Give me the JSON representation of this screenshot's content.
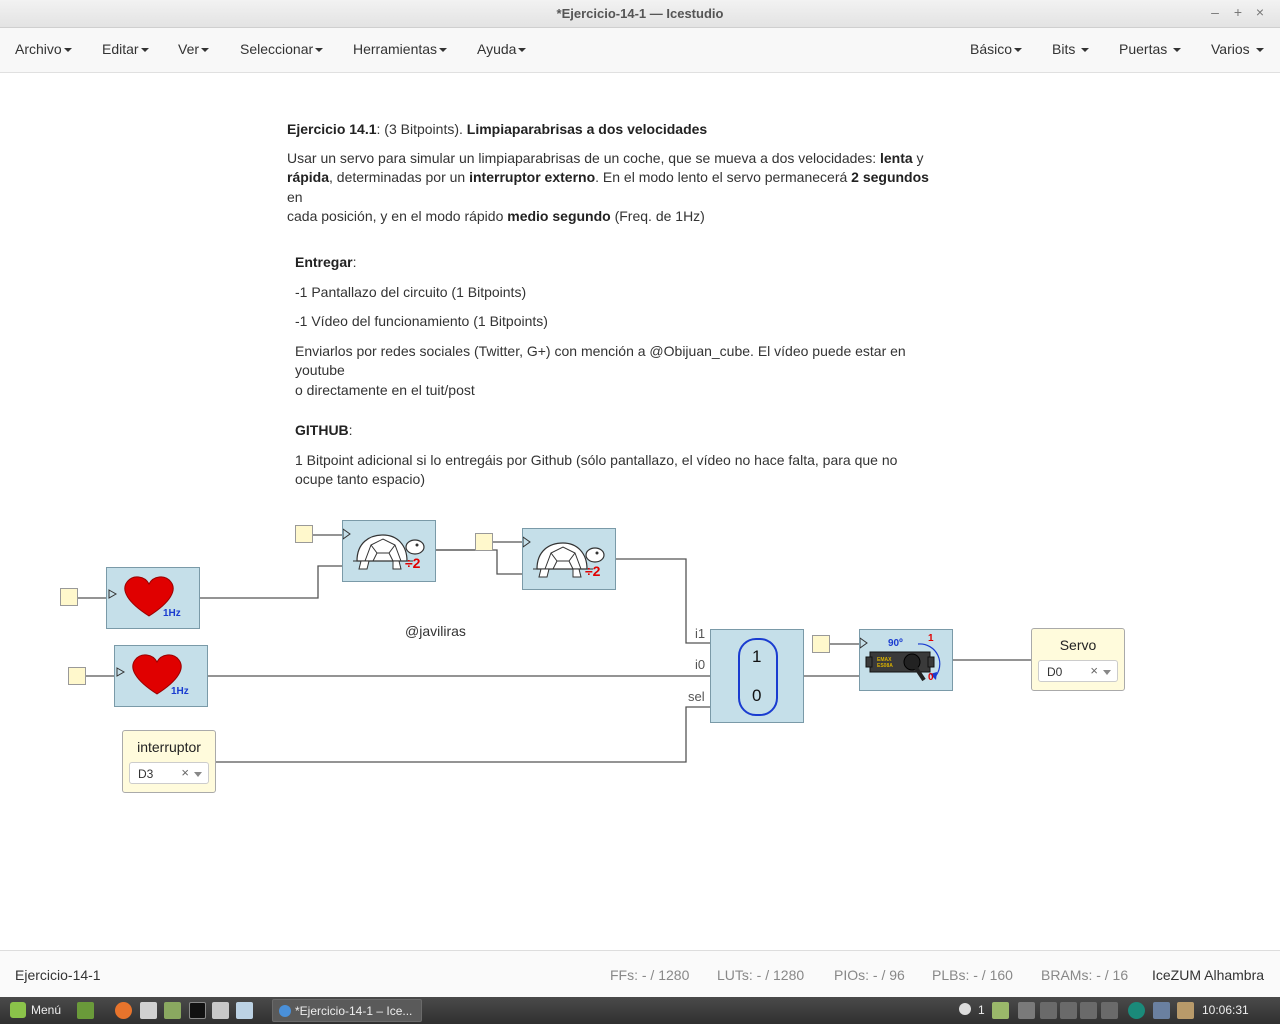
{
  "window": {
    "title": "*Ejercicio-14-1 — Icestudio",
    "minimize": "–",
    "maximize": "+",
    "close": "×"
  },
  "menubar": {
    "left": [
      "Archivo",
      "Editar",
      "Ver",
      "Seleccionar",
      "Herramientas",
      "Ayuda"
    ],
    "right": [
      "Básico",
      "Bits",
      "Puertas",
      "Varios"
    ]
  },
  "description": {
    "title_prefix": "Ejercicio 14.1",
    "title_mid": ": (3 Bitpoints). ",
    "title_bold": "Limpiaparabrisas a dos velocidades",
    "p1_a": "Usar un servo para simular un limpiaparabrisas de un coche, que se mueva a dos velocidades: ",
    "p1_b": "lenta",
    "p1_c": " y",
    "p1_d": "rápida",
    "p1_e": ", determinadas por un ",
    "p1_f": "interruptor externo",
    "p1_g": ". En el modo lento el servo permanecerá ",
    "p1_h": "2 segundos",
    "p1_i": " en",
    "p1_j": "cada posición, y en el modo rápido ",
    "p1_k": "medio segundo",
    "p1_l": " (Freq. de 1Hz)",
    "entregar": "Entregar",
    "entregar_colon": ":",
    "item1": "-1 Pantallazo del circuito (1 Bitpoints)",
    "item2": "-1 Vídeo del funcionamiento (1 Bitpoints)",
    "enviar_line1": "Enviarlos por redes sociales (Twitter, G+) con mención a @Obijuan_cube. El vídeo puede estar en youtube",
    "enviar_line2": "o directamente en el tuit/post",
    "github": "GITHUB",
    "github_colon": ":",
    "github_line1": "1 Bitpoint adicional si lo entregáis por Github (sólo pantallazo, el vídeo no hace falta, para que no",
    "github_line2": "ocupe tanto espacio)"
  },
  "circuit": {
    "author": "@javiliras",
    "heart_freq": "1Hz",
    "divider": "÷2",
    "mux": {
      "in1": "i1",
      "in0": "i0",
      "sel": "sel",
      "top": "1",
      "bottom": "0"
    },
    "servo_icon": {
      "angle": "90º",
      "one": "1",
      "zero": "0",
      "brand": "EMAX ES08A"
    },
    "input_block": {
      "name": "interruptor",
      "pin": "D3"
    },
    "output_block": {
      "name": "Servo",
      "pin": "D0"
    },
    "clear_symbol": "×"
  },
  "statusbar": {
    "project": "Ejercicio-14-1",
    "ffs": "FFs:  - / 1280",
    "luts": "LUTs:  - / 1280",
    "pios": "PIOs:  - / 96",
    "plbs": "PLBs:  - / 160",
    "brams": "BRAMs:  - / 16",
    "board": "IceZUM Alhambra"
  },
  "taskbar": {
    "menu": "Menú",
    "task": "*Ejercicio-14-1 – Ice...",
    "notifications": "1",
    "clock": "10:06:31"
  },
  "colors": {
    "block": "#c5dfe9",
    "port": "#fff8cc",
    "heart": "#e00000",
    "wire": "#555555"
  }
}
